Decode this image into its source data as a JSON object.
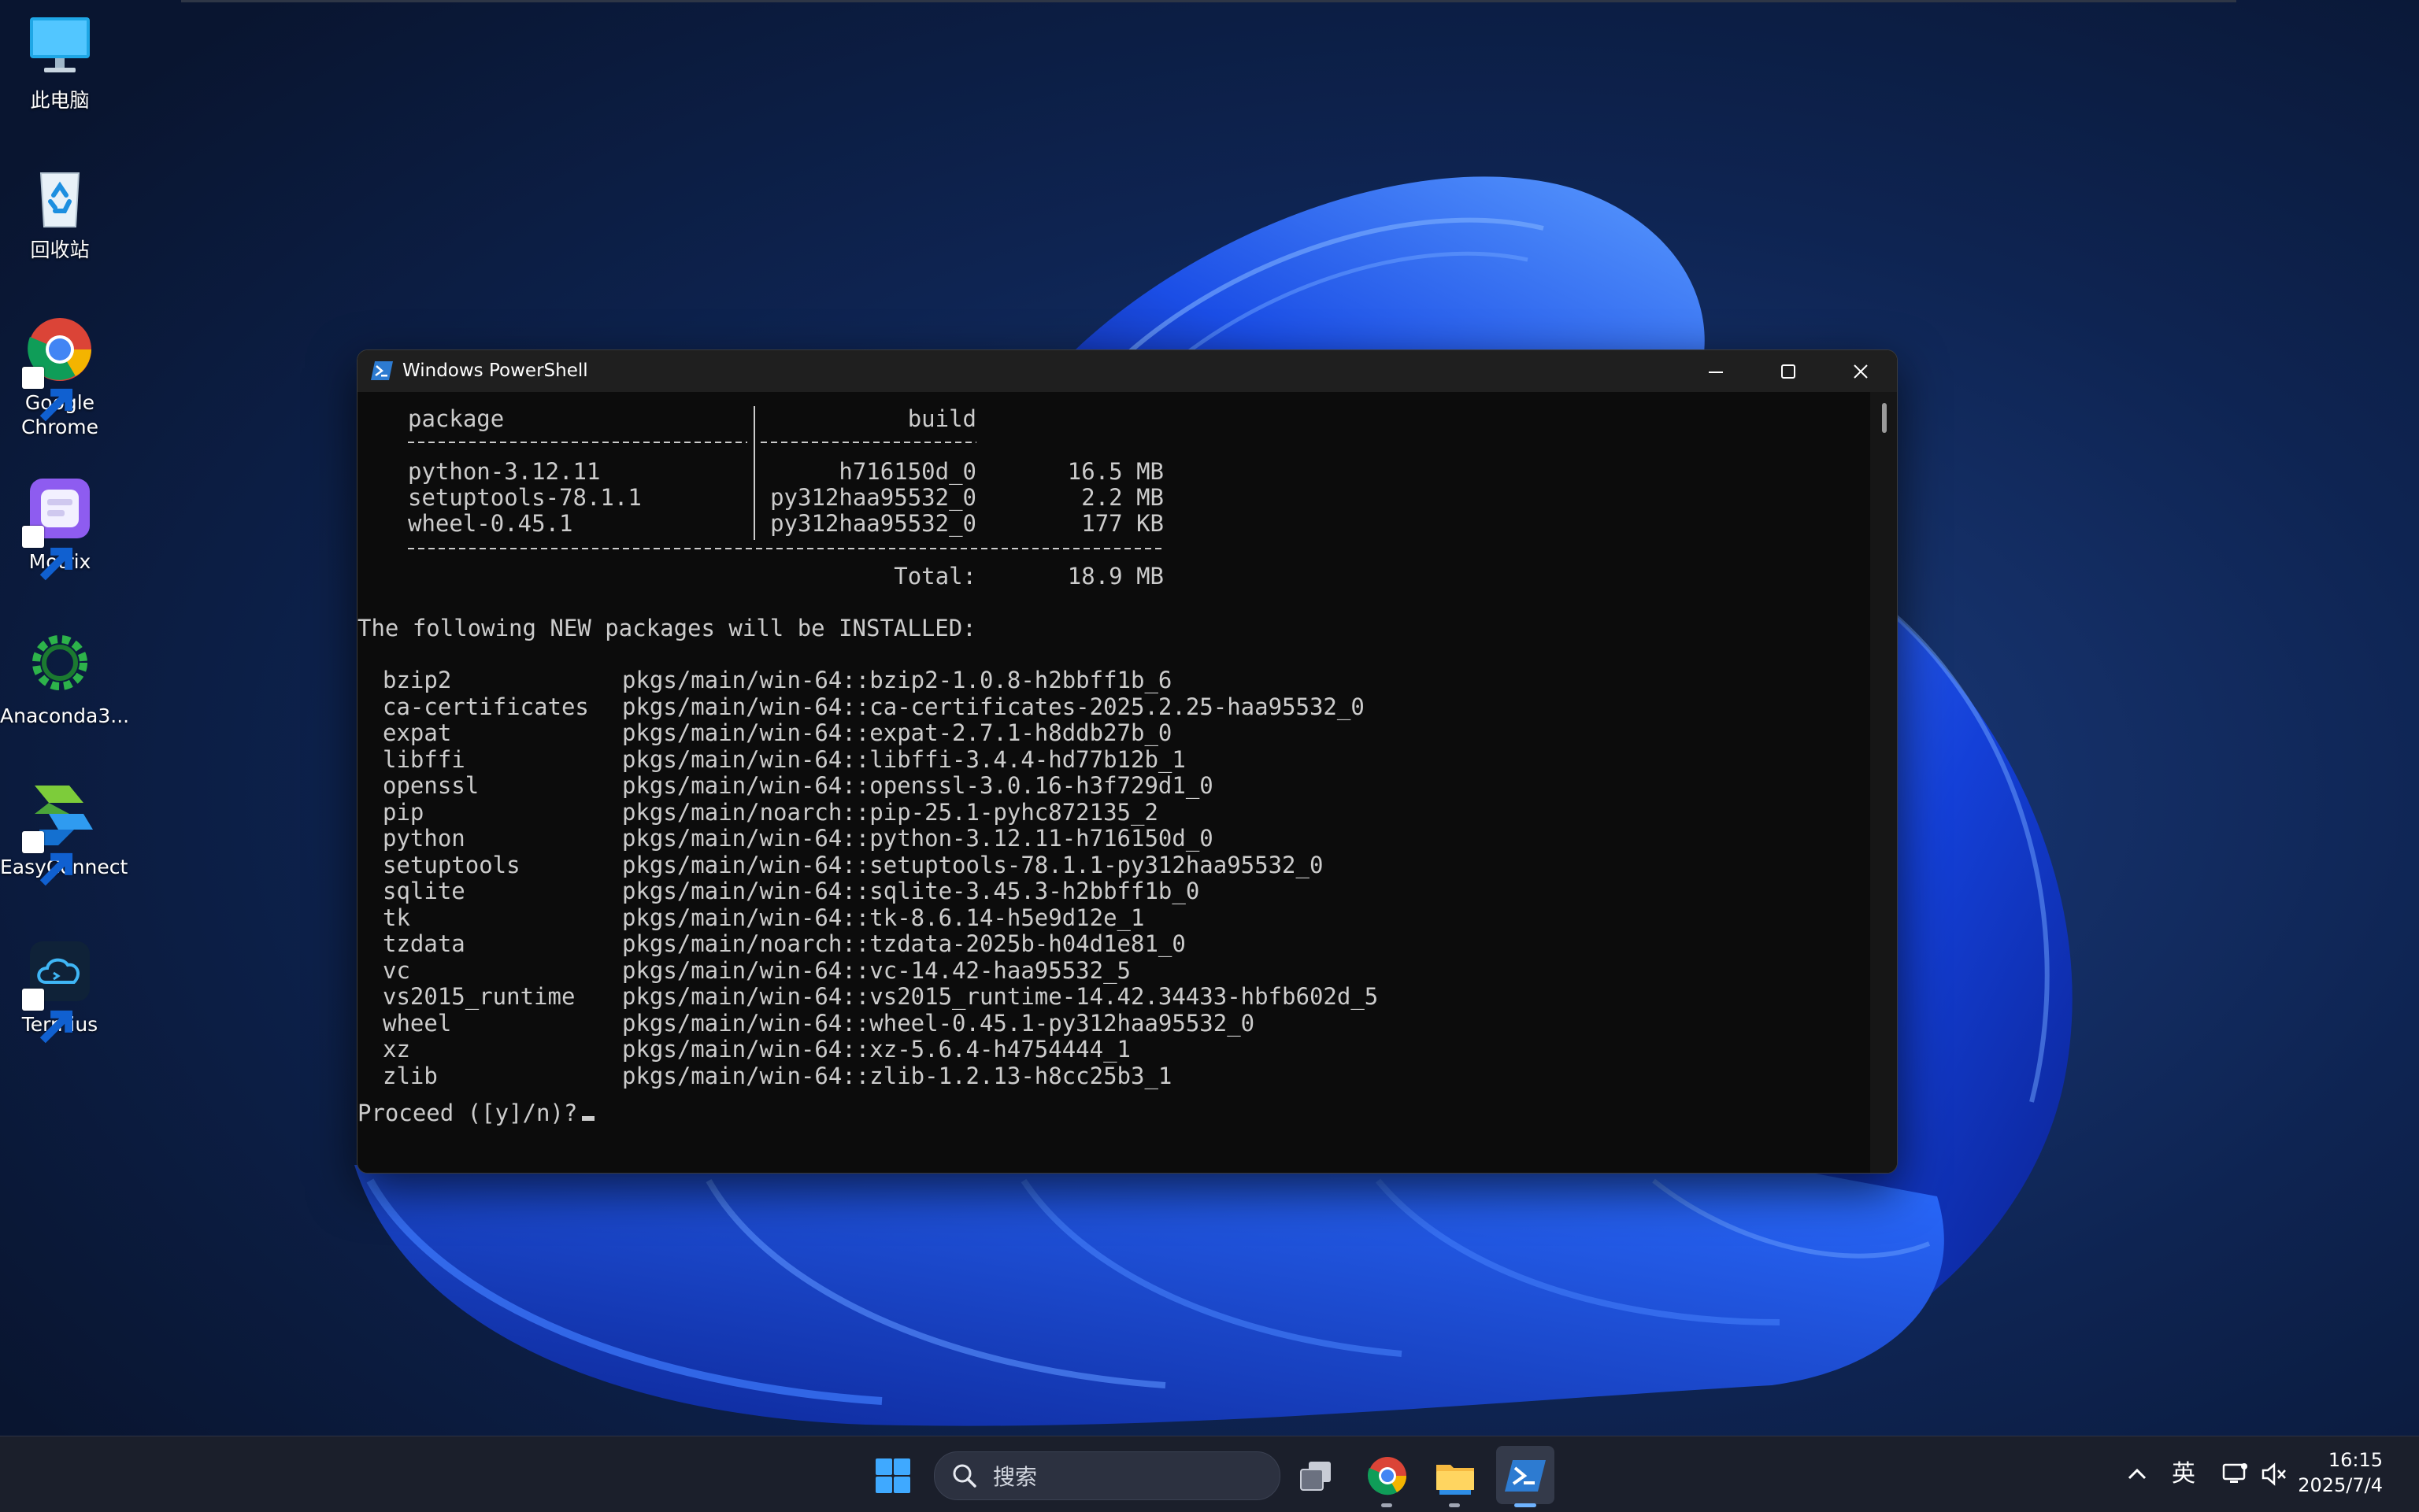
{
  "desktop": {
    "icons": [
      {
        "label": "此电脑",
        "icon": "computer-icon"
      },
      {
        "label": "回收站",
        "icon": "recycle-bin-icon"
      },
      {
        "label": "Google\nChrome",
        "icon": "chrome-icon",
        "shortcut": true
      },
      {
        "label": "Motrix",
        "icon": "motrix-icon",
        "shortcut": true
      },
      {
        "label": "Anaconda3...",
        "icon": "anaconda-icon"
      },
      {
        "label": "EasyConnect",
        "icon": "easyconnect-icon",
        "shortcut": true
      },
      {
        "label": "Termius",
        "icon": "termius-icon",
        "shortcut": true
      }
    ]
  },
  "window": {
    "title": "Windows PowerShell",
    "icon": "powershell-icon",
    "controls": [
      "minimize-icon",
      "maximize-icon",
      "close-icon"
    ]
  },
  "console": {
    "summary_header": {
      "package": "package",
      "build": "build"
    },
    "summary_rows": [
      {
        "package": "python-3.12.11",
        "build": "h716150d_0",
        "size": "16.5 MB"
      },
      {
        "package": "setuptools-78.1.1",
        "build": "py312haa95532_0",
        "size": "2.2 MB"
      },
      {
        "package": "wheel-0.45.1",
        "build": "py312haa95532_0",
        "size": "177 KB"
      }
    ],
    "total_label": "Total:",
    "total_value": "18.9 MB",
    "new_packages_heading": "The following NEW packages will be INSTALLED:",
    "new_packages": [
      {
        "name": "bzip2",
        "spec": "pkgs/main/win-64::bzip2-1.0.8-h2bbff1b_6"
      },
      {
        "name": "ca-certificates",
        "spec": "pkgs/main/win-64::ca-certificates-2025.2.25-haa95532_0"
      },
      {
        "name": "expat",
        "spec": "pkgs/main/win-64::expat-2.7.1-h8ddb27b_0"
      },
      {
        "name": "libffi",
        "spec": "pkgs/main/win-64::libffi-3.4.4-hd77b12b_1"
      },
      {
        "name": "openssl",
        "spec": "pkgs/main/win-64::openssl-3.0.16-h3f729d1_0"
      },
      {
        "name": "pip",
        "spec": "pkgs/main/noarch::pip-25.1-pyhc872135_2"
      },
      {
        "name": "python",
        "spec": "pkgs/main/win-64::python-3.12.11-h716150d_0"
      },
      {
        "name": "setuptools",
        "spec": "pkgs/main/win-64::setuptools-78.1.1-py312haa95532_0"
      },
      {
        "name": "sqlite",
        "spec": "pkgs/main/win-64::sqlite-3.45.3-h2bbff1b_0"
      },
      {
        "name": "tk",
        "spec": "pkgs/main/win-64::tk-8.6.14-h5e9d12e_1"
      },
      {
        "name": "tzdata",
        "spec": "pkgs/main/noarch::tzdata-2025b-h04d1e81_0"
      },
      {
        "name": "vc",
        "spec": "pkgs/main/win-64::vc-14.42-haa95532_5"
      },
      {
        "name": "vs2015_runtime",
        "spec": "pkgs/main/win-64::vs2015_runtime-14.42.34433-hbfb602d_5"
      },
      {
        "name": "wheel",
        "spec": "pkgs/main/win-64::wheel-0.45.1-py312haa95532_0"
      },
      {
        "name": "xz",
        "spec": "pkgs/main/win-64::xz-5.6.4-h4754444_1"
      },
      {
        "name": "zlib",
        "spec": "pkgs/main/win-64::zlib-1.2.13-h8cc25b3_1"
      }
    ],
    "prompt": "Proceed ([y]/n)?"
  },
  "taskbar": {
    "search_placeholder": "搜索",
    "apps": [
      "start-icon",
      "task-view-icon",
      "chrome-icon",
      "file-explorer-icon",
      "powershell-icon"
    ],
    "tray": {
      "ime": "英",
      "icons": [
        "chevron-up-icon",
        "network-icon",
        "volume-muted-icon"
      ]
    },
    "time": "16:15",
    "date": "2025/7/4"
  },
  "colors": {
    "console_bg": "#0c0c0c",
    "console_text": "#cccccc",
    "titlebar_bg": "#1f1f1f",
    "taskbar_bg": "#1b1f2b"
  }
}
